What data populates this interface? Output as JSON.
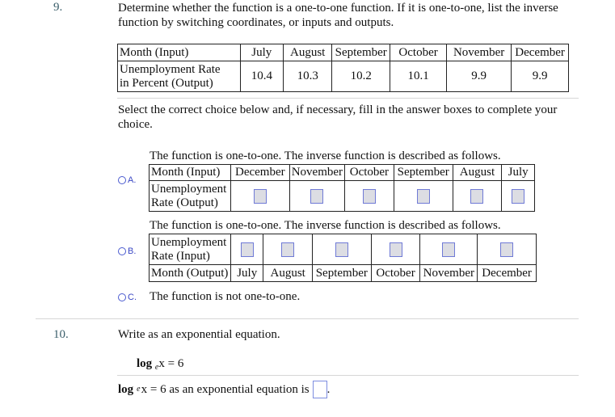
{
  "question9": {
    "number": "9.",
    "prompt_line1": "Determine whether the function is a one-to-one function. If it is one-to-one, list the inverse",
    "prompt_line2": "function by switching coordinates, or inputs and outputs.",
    "table": {
      "row1_header": "Month (Input)",
      "row2_header_line1": "Unemployment Rate",
      "row2_header_line2": "in Percent (Output)",
      "months": [
        "July",
        "August",
        "September",
        "October",
        "November",
        "December"
      ],
      "rates": [
        "10.4",
        "10.3",
        "10.2",
        "10.1",
        "9.9",
        "9.9"
      ]
    },
    "instruction_line1": "Select the correct choice below and, if necessary, fill in the answer boxes to complete your",
    "instruction_line2": "choice.",
    "choices": {
      "a": {
        "label": "A.",
        "caption": "The function is one-to-one. The inverse function is described as follows.",
        "row1_header": "Month (Input)",
        "row2_header_line1": "Unemployment",
        "row2_header_line2": "Rate (Output)",
        "months": [
          "December",
          "November",
          "October",
          "September",
          "August",
          "July"
        ],
        "selected": false
      },
      "b": {
        "label": "B.",
        "caption": "The function is one-to-one. The inverse function is described as follows.",
        "row1_header_line1": "Unemployment",
        "row1_header_line2": "Rate (Input)",
        "row2_header": "Month (Output)",
        "months": [
          "July",
          "August",
          "September",
          "October",
          "November",
          "December"
        ],
        "selected": false
      },
      "c": {
        "label": "C.",
        "caption": "The function is not one-to-one.",
        "selected": false
      }
    }
  },
  "question10": {
    "number": "10.",
    "prompt": "Write as an exponential equation.",
    "equation": {
      "log": "log",
      "base": "e",
      "rest": "x = 6"
    },
    "answer_prefix_rest": "x = 6 as an exponential equation is",
    "answer_suffix": "."
  },
  "colors": {
    "accent": "#3b48c4",
    "answer_box_fill": "#dcdde3",
    "answer_box_border": "#6f7ad6",
    "question_number": "#3a5e6a"
  }
}
